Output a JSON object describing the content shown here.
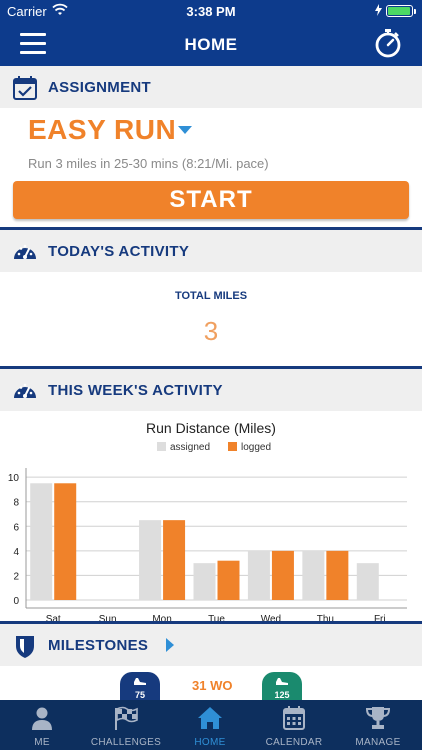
{
  "status_bar": {
    "carrier": "Carrier",
    "time": "3:38 PM",
    "battery_level": 0.95
  },
  "nav": {
    "title": "HOME"
  },
  "assignment": {
    "header": "ASSIGNMENT",
    "name": "EASY RUN",
    "description": "Run 3 miles in 25-30 mins (8:21/Mi. pace)",
    "start_label": "START"
  },
  "today": {
    "header": "TODAY'S ACTIVITY",
    "total_miles_label": "TOTAL MILES",
    "total_miles_value": "3"
  },
  "week": {
    "header": "THIS WEEK'S ACTIVITY"
  },
  "chart_data": {
    "type": "bar",
    "title": "Run Distance (Miles)",
    "categories": [
      "Sat",
      "Sun",
      "Mon",
      "Tue",
      "Wed",
      "Thu",
      "Fri"
    ],
    "series": [
      {
        "name": "assigned",
        "color": "#dddddd",
        "values": [
          9.5,
          0,
          6.5,
          3,
          4,
          4,
          3
        ]
      },
      {
        "name": "logged",
        "color": "#f0822a",
        "values": [
          9.5,
          0,
          6.5,
          3.2,
          4,
          4,
          0
        ]
      }
    ],
    "yticks": [
      0,
      2,
      4,
      6,
      8,
      10
    ],
    "ylim": [
      0,
      10.5
    ],
    "legend_position": "top",
    "grid": true
  },
  "milestones": {
    "header": "MILESTONES",
    "badge_left": "75",
    "workouts": "31 WO",
    "badge_right": "125",
    "badge_left_color": "#163a7e",
    "badge_right_color": "#1a8a6e"
  },
  "tabs": [
    {
      "label": "ME",
      "icon": "person-icon",
      "active": false
    },
    {
      "label": "CHALLENGES",
      "icon": "checkered-flag-icon",
      "active": false
    },
    {
      "label": "HOME",
      "icon": "house-icon",
      "active": true
    },
    {
      "label": "CALENDAR",
      "icon": "calendar-icon",
      "active": false
    },
    {
      "label": "MANAGE",
      "icon": "trophy-icon",
      "active": false
    }
  ],
  "colors": {
    "primary": "#0d3b8c",
    "accent": "#f0822a",
    "header_text": "#163a7e",
    "tab_bar": "#0d2f5e",
    "active_tab": "#2f8fd6"
  }
}
